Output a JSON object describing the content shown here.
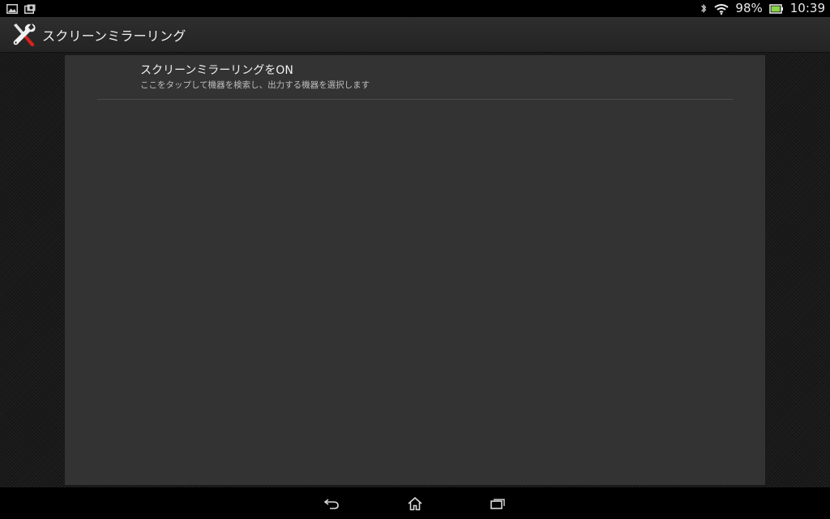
{
  "status_bar": {
    "battery_percent": "98%",
    "time": "10:39",
    "icons": [
      "picture-notification-icon",
      "camera-notification-icon",
      "bluetooth-icon",
      "wifi-icon",
      "battery-icon"
    ],
    "battery_color": "#8bd34a"
  },
  "action_bar": {
    "title": "スクリーンミラーリング",
    "icon": "tools-icon"
  },
  "list": {
    "items": [
      {
        "title": "スクリーンミラーリングをON",
        "summary": "ここをタップして機器を検索し、出力する機器を選択します"
      }
    ]
  },
  "nav_bar": {
    "buttons": [
      "back-icon",
      "home-icon",
      "recent-apps-icon"
    ]
  },
  "colors": {
    "panel": "#333333",
    "background": "#1b1b1b",
    "accent_red": "#d8221c"
  }
}
